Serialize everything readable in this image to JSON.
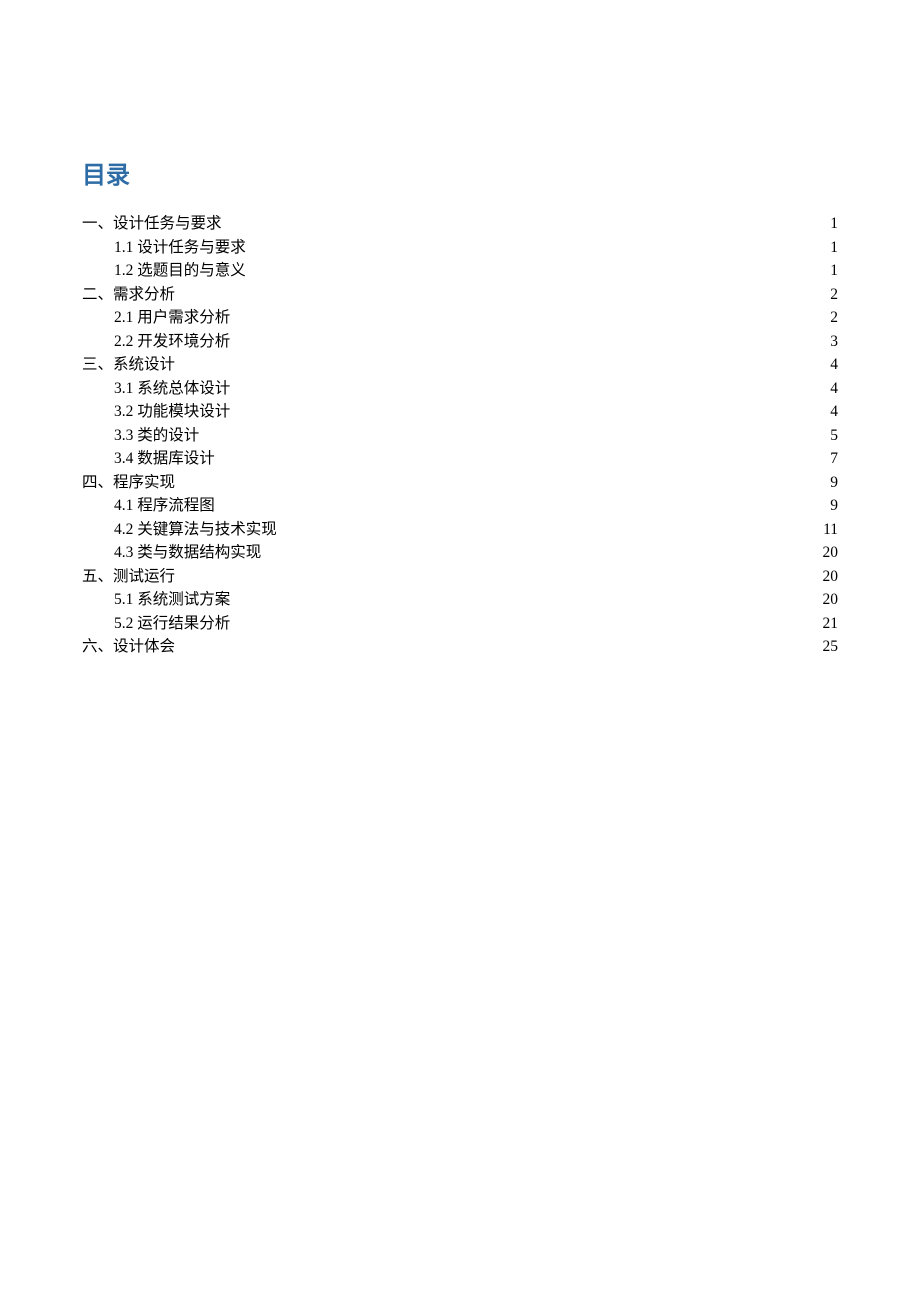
{
  "title": "目录",
  "entries": [
    {
      "level": 1,
      "label": "一、设计任务与要求",
      "page": "1"
    },
    {
      "level": 2,
      "label": "1.1  设计任务与要求",
      "page": "1"
    },
    {
      "level": 2,
      "label": "1.2  选题目的与意义",
      "page": "1"
    },
    {
      "level": 1,
      "label": "二、需求分析",
      "page": "2"
    },
    {
      "level": 2,
      "label": "2.1  用户需求分析",
      "page": "2"
    },
    {
      "level": 2,
      "label": "2.2  开发环境分析",
      "page": "3"
    },
    {
      "level": 1,
      "label": "三、系统设计",
      "page": "4"
    },
    {
      "level": 2,
      "label": "3.1  系统总体设计",
      "page": "4"
    },
    {
      "level": 2,
      "label": "3.2  功能模块设计",
      "page": "4"
    },
    {
      "level": 2,
      "label": "3.3  类的设计",
      "page": "5"
    },
    {
      "level": 2,
      "label": "3.4  数据库设计",
      "page": "7"
    },
    {
      "level": 1,
      "label": "四、程序实现",
      "page": "9"
    },
    {
      "level": 2,
      "label": "4.1  程序流程图",
      "page": "9"
    },
    {
      "level": 2,
      "label": "4.2  关键算法与技术实现",
      "page": "11"
    },
    {
      "level": 2,
      "label": "4.3  类与数据结构实现",
      "page": "20"
    },
    {
      "level": 1,
      "label": "五、测试运行",
      "page": "20"
    },
    {
      "level": 2,
      "label": "5.1  系统测试方案",
      "page": "20"
    },
    {
      "level": 2,
      "label": "5.2  运行结果分析",
      "page": "21"
    },
    {
      "level": 1,
      "label": "六、设计体会",
      "page": "25"
    }
  ]
}
